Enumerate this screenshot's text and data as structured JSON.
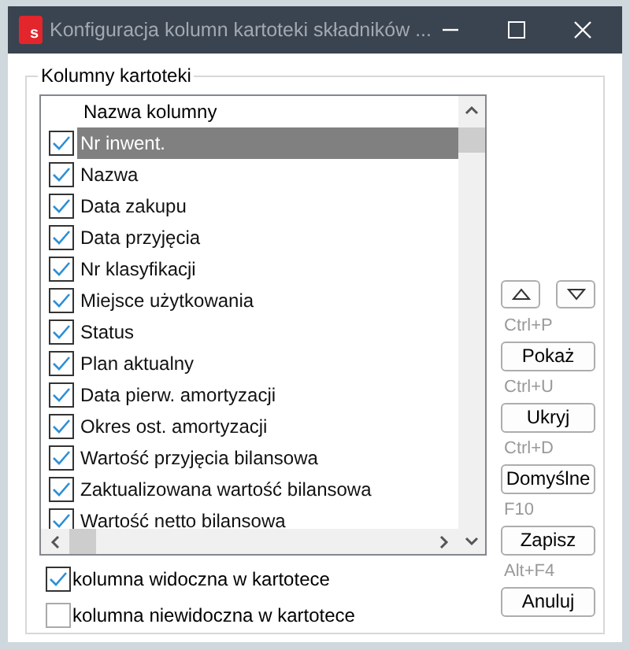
{
  "window": {
    "title": "Konfiguracja kolumn kartoteki składników ...",
    "app_icon_letter": "s"
  },
  "group": {
    "title": "Kolumny kartoteki"
  },
  "list": {
    "header": "Nazwa kolumny",
    "rows": [
      {
        "label": "Nr inwent.",
        "checked": true,
        "selected": true
      },
      {
        "label": "Nazwa",
        "checked": true,
        "selected": false
      },
      {
        "label": "Data zakupu",
        "checked": true,
        "selected": false
      },
      {
        "label": "Data przyjęcia",
        "checked": true,
        "selected": false
      },
      {
        "label": "Nr klasyfikacji",
        "checked": true,
        "selected": false
      },
      {
        "label": "Miejsce użytkowania",
        "checked": true,
        "selected": false
      },
      {
        "label": "Status",
        "checked": true,
        "selected": false
      },
      {
        "label": "Plan aktualny",
        "checked": true,
        "selected": false
      },
      {
        "label": "Data pierw. amortyzacji",
        "checked": true,
        "selected": false
      },
      {
        "label": "Okres ost. amortyzacji",
        "checked": true,
        "selected": false
      },
      {
        "label": "Wartość przyjęcia bilansowa",
        "checked": true,
        "selected": false
      },
      {
        "label": "Zaktualizowana wartość bilansowa",
        "checked": true,
        "selected": false
      },
      {
        "label": "Wartość netto bilansowa",
        "checked": true,
        "selected": false
      }
    ]
  },
  "buttons": [
    {
      "shortcut": "Ctrl+P",
      "label": "Pokaż"
    },
    {
      "shortcut": "Ctrl+U",
      "label": "Ukryj"
    },
    {
      "shortcut": "Ctrl+D",
      "label": "Domyślne"
    },
    {
      "shortcut": "F10",
      "label": "Zapisz"
    },
    {
      "shortcut": "Alt+F4",
      "label": "Anuluj"
    }
  ],
  "legend": [
    {
      "label": "kolumna widoczna w kartotece",
      "checked": true
    },
    {
      "label": "kolumna niewidoczna w kartotece",
      "checked": false
    }
  ]
}
